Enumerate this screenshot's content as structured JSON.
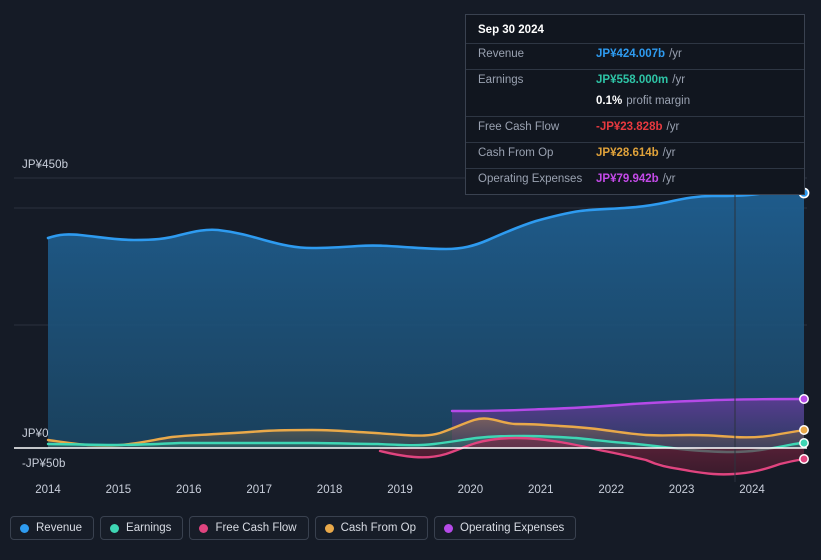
{
  "tooltip": {
    "date": "Sep 30 2024",
    "rows": [
      {
        "label": "Revenue",
        "value": "JP¥424.007b",
        "suffix": "/yr",
        "color": "#2e9bf0"
      },
      {
        "label": "Earnings",
        "value": "JP¥558.000m",
        "suffix": "/yr",
        "color": "#2ec4a6"
      },
      {
        "label": "",
        "value": "0.1%",
        "suffix": "profit margin",
        "color": "#ffffff"
      },
      {
        "label": "Free Cash Flow",
        "value": "-JP¥23.828b",
        "suffix": "/yr",
        "color": "#e8393f"
      },
      {
        "label": "Cash From Op",
        "value": "JP¥28.614b",
        "suffix": "/yr",
        "color": "#e0a23a"
      },
      {
        "label": "Operating Expenses",
        "value": "JP¥79.942b",
        "suffix": "/yr",
        "color": "#c44ae8"
      }
    ]
  },
  "legend": [
    {
      "label": "Revenue",
      "color": "#2e9bf0"
    },
    {
      "label": "Earnings",
      "color": "#3ed6b4"
    },
    {
      "label": "Free Cash Flow",
      "color": "#e0447f"
    },
    {
      "label": "Cash From Op",
      "color": "#e9a94a"
    },
    {
      "label": "Operating Expenses",
      "color": "#b54ae8"
    }
  ],
  "axis": {
    "y_top_label": "JP¥450b",
    "y_zero_label": "JP¥0",
    "y_neg_label": "-JP¥50b",
    "x_labels": [
      "2014",
      "2015",
      "2016",
      "2017",
      "2018",
      "2019",
      "2020",
      "2021",
      "2022",
      "2023",
      "2024"
    ]
  },
  "chart_data": {
    "type": "area",
    "title": "",
    "xlabel": "",
    "ylabel": "JP¥",
    "ylim": [
      -50,
      450
    ],
    "y_ticks": [
      450,
      0,
      -50
    ],
    "y_tick_labels": [
      "JP¥450b",
      "JP¥0",
      "-JP¥50b"
    ],
    "grid": true,
    "legend_position": "bottom",
    "x": [
      2013.8,
      2014.0,
      2014.3,
      2014.6,
      2015.0,
      2015.3,
      2015.7,
      2016.0,
      2016.3,
      2016.7,
      2017.0,
      2017.3,
      2017.7,
      2018.0,
      2018.3,
      2018.7,
      2019.0,
      2019.3,
      2019.7,
      2020.0,
      2020.3,
      2020.7,
      2021.0,
      2021.3,
      2021.7,
      2022.0,
      2022.3,
      2022.7,
      2023.0,
      2023.3,
      2023.7,
      2024.0,
      2024.3,
      2024.75
    ],
    "x_tick_labels": [
      "2014",
      "2015",
      "2016",
      "2017",
      "2018",
      "2019",
      "2020",
      "2021",
      "2022",
      "2023",
      "2024"
    ],
    "units": "JP¥ billions per year",
    "series": [
      {
        "name": "Revenue",
        "color": "#2e9bf0",
        "values": [
          350,
          354,
          352,
          350,
          348,
          349,
          358,
          363,
          362,
          357,
          352,
          345,
          338,
          334,
          333,
          333,
          336,
          338,
          334,
          332,
          330,
          332,
          340,
          352,
          362,
          370,
          378,
          385,
          390,
          389,
          394,
          404,
          414,
          424.007
        ],
        "end_label": "JP¥424.007b"
      },
      {
        "name": "Earnings",
        "color": "#3ed6b4",
        "values": [
          6,
          6,
          6,
          5,
          4,
          4,
          5,
          6,
          7,
          7,
          8,
          8,
          8,
          9,
          9,
          8,
          7,
          6,
          6,
          8,
          12,
          15,
          16,
          15,
          14,
          13,
          11,
          8,
          5,
          2,
          1,
          0.8,
          0.6,
          0.558
        ],
        "end_label": "JP¥558.000m"
      },
      {
        "name": "Free Cash Flow",
        "color": "#e0447f",
        "values": [
          null,
          null,
          null,
          null,
          null,
          null,
          null,
          null,
          null,
          null,
          null,
          null,
          null,
          null,
          null,
          -5,
          -9,
          -12,
          -8,
          2,
          9,
          11,
          10,
          9,
          7,
          2,
          -6,
          -14,
          -22,
          -32,
          -41,
          -43,
          -36,
          -23.828
        ],
        "end_label": "-JP¥23.828b"
      },
      {
        "name": "Cash From Op",
        "color": "#e9a94a",
        "values": [
          14,
          12,
          9,
          6,
          4,
          6,
          9,
          12,
          15,
          18,
          20,
          20,
          19,
          18,
          17,
          16,
          15,
          14,
          16,
          26,
          38,
          41,
          40,
          38,
          36,
          33,
          25,
          21,
          20,
          19,
          16,
          16,
          21,
          28.614
        ],
        "end_label": "JP¥28.614b"
      },
      {
        "name": "Operating Expenses",
        "color": "#b54ae8",
        "values": [
          null,
          null,
          null,
          null,
          null,
          null,
          null,
          null,
          null,
          null,
          null,
          null,
          null,
          null,
          null,
          null,
          null,
          null,
          null,
          62,
          62,
          62,
          63,
          64,
          65,
          67,
          70,
          72,
          74,
          75,
          76,
          77,
          78,
          79.942
        ],
        "end_label": "JP¥79.942b"
      }
    ]
  }
}
